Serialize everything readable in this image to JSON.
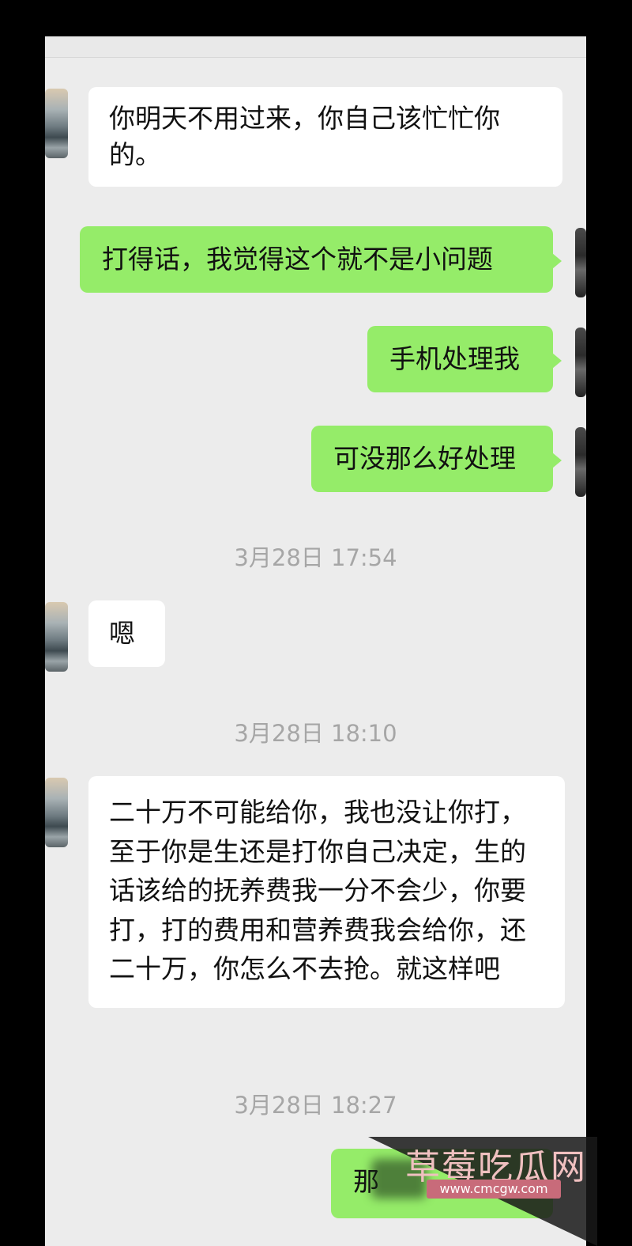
{
  "messages": [
    {
      "side": "in",
      "text": "你明天不用过来，你自己该忙忙你的。"
    },
    {
      "side": "out",
      "text": "打得话，我觉得这个就不是小问题"
    },
    {
      "side": "out",
      "text": "手机处理我"
    },
    {
      "side": "out",
      "text": "可没那么好处理"
    },
    {
      "type": "time",
      "text": "3月28日 17:54"
    },
    {
      "side": "in",
      "text": "嗯"
    },
    {
      "type": "time",
      "text": "3月28日 18:10"
    },
    {
      "side": "in",
      "text": "二十万不可能给你，我也没让你打，至于你是生还是打你自己决定，生的话该给的抚养费我一分不会少，你要打，打的费用和营养费我会给你，还二十万，你怎么不去抢。就这样吧"
    },
    {
      "type": "time",
      "text": "3月28日 18:27"
    },
    {
      "side": "out",
      "text": "那"
    }
  ],
  "watermark": {
    "title": "草莓吃瓜网",
    "url": "www.cmcgw.com"
  },
  "colors": {
    "outgoing": "#95ec69",
    "incoming": "#ffffff",
    "background": "#ececec"
  }
}
